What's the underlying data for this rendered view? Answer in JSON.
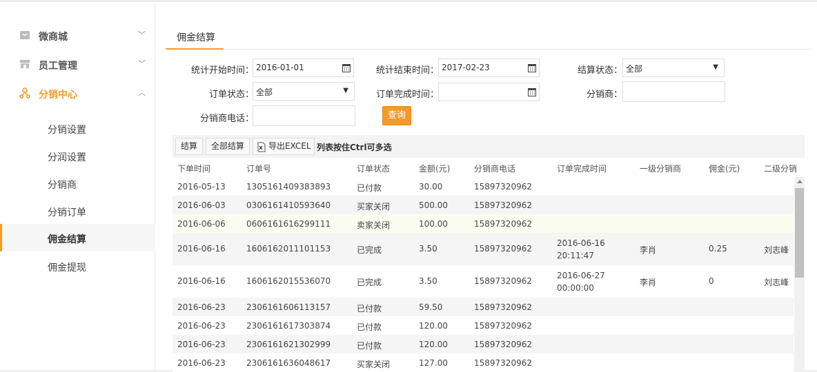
{
  "sidebar": {
    "groups": [
      {
        "label": "微商城",
        "icon": "shop-icon",
        "state": "collapsed"
      },
      {
        "label": "员工管理",
        "icon": "store-icon",
        "state": "collapsed"
      },
      {
        "label": "分销中心",
        "icon": "distribution-icon",
        "state": "expanded"
      }
    ],
    "sub_items": [
      {
        "label": "分销设置"
      },
      {
        "label": "分润设置"
      },
      {
        "label": "分销商"
      },
      {
        "label": "分销订单"
      },
      {
        "label": "佣金结算"
      },
      {
        "label": "佣金提现"
      }
    ],
    "selected": "佣金结算"
  },
  "tab": {
    "label": "佣金结算"
  },
  "filters": {
    "start_time": {
      "label": "统计开始时间：",
      "value": "2016-01-01"
    },
    "end_time": {
      "label": "统计结束时间：",
      "value": "2017-02-23"
    },
    "settle_status": {
      "label": "结算状态：",
      "value": "全部"
    },
    "order_status": {
      "label": "订单状态：",
      "value": "全部"
    },
    "finish_time": {
      "label": "订单完成时间：",
      "value": ""
    },
    "distributor": {
      "label": "分销商：",
      "value": ""
    },
    "distributor_phone": {
      "label": "分销商电话：",
      "value": ""
    },
    "query_label": "查询"
  },
  "toolbar": {
    "settle_label": "结算",
    "settle_all_label": "全部结算",
    "export_label": "导出EXCEL",
    "hint": "列表按住Ctrl可多选"
  },
  "table": {
    "columns": [
      "下单时间",
      "订单号",
      "订单状态",
      "金额(元)",
      "分销商电话",
      "订单完成时间",
      "一级分销商",
      "佣金(元)",
      "二级分销"
    ],
    "rows": [
      {
        "date": "2016-05-13",
        "order": "1305161409383893",
        "status": "已付款",
        "amount": "30.00",
        "phone": "15897320962",
        "finish": "",
        "lvl1": "",
        "commission": "",
        "lvl2": ""
      },
      {
        "date": "2016-06-03",
        "order": "0306161410593640",
        "status": "买家关闭",
        "amount": "500.00",
        "phone": "15897320962",
        "finish": "",
        "lvl1": "",
        "commission": "",
        "lvl2": ""
      },
      {
        "date": "2016-06-06",
        "order": "0606161616299111",
        "status": "卖家关闭",
        "amount": "100.00",
        "phone": "15897320962",
        "finish": "",
        "lvl1": "",
        "commission": "",
        "lvl2": ""
      },
      {
        "date": "2016-06-16",
        "order": "1606162011101153",
        "status": "已完成",
        "amount": "3.50",
        "phone": "15897320962",
        "finish": "2016-06-16 20:11:47",
        "lvl1": "李肖",
        "commission": "0.25",
        "lvl2": "刘志峰"
      },
      {
        "date": "2016-06-16",
        "order": "1606162015536070",
        "status": "已完成",
        "amount": "3.50",
        "phone": "15897320962",
        "finish": "2016-06-27 00:00:00",
        "lvl1": "李肖",
        "commission": "0",
        "lvl2": "刘志峰"
      },
      {
        "date": "2016-06-23",
        "order": "2306161606113157",
        "status": "已付款",
        "amount": "59.50",
        "phone": "15897320962",
        "finish": "",
        "lvl1": "",
        "commission": "",
        "lvl2": ""
      },
      {
        "date": "2016-06-23",
        "order": "2306161617303874",
        "status": "已付款",
        "amount": "120.00",
        "phone": "15897320962",
        "finish": "",
        "lvl1": "",
        "commission": "",
        "lvl2": ""
      },
      {
        "date": "2016-06-23",
        "order": "2306161621302999",
        "status": "已付款",
        "amount": "120.00",
        "phone": "15897320962",
        "finish": "",
        "lvl1": "",
        "commission": "",
        "lvl2": ""
      },
      {
        "date": "2016-06-23",
        "order": "2306161636048617",
        "status": "买家关闭",
        "amount": "127.00",
        "phone": "15897320962",
        "finish": "",
        "lvl1": "",
        "commission": "",
        "lvl2": ""
      }
    ]
  },
  "colors": {
    "accent": "#f39a2b",
    "selected_bg": "#f7f7f7",
    "row_alt": "#f5f5f5",
    "row_highlight": "#fdfcf1"
  }
}
